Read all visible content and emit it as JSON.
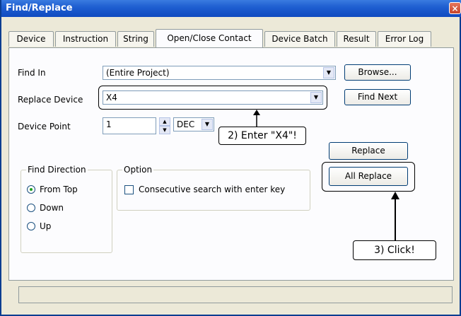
{
  "window": {
    "title": "Find/Replace",
    "close_glyph": "×"
  },
  "tabs": [
    "Device",
    "Instruction",
    "String",
    "Open/Close Contact",
    "Device Batch",
    "Result",
    "Error Log"
  ],
  "active_tab": "Open/Close Contact",
  "find_in": {
    "label": "Find In",
    "value": "(Entire Project)"
  },
  "replace_device": {
    "label": "Replace Device",
    "value": "X4"
  },
  "device_point": {
    "label": "Device Point",
    "value": "1",
    "format": "DEC"
  },
  "buttons": {
    "browse": "Browse...",
    "find_next": "Find Next",
    "replace": "Replace",
    "all_replace": "All Replace"
  },
  "find_direction": {
    "title": "Find Direction",
    "options": [
      "From Top",
      "Down",
      "Up"
    ],
    "selected": "From Top"
  },
  "option": {
    "title": "Option",
    "checkbox_label": "Consecutive search with enter key",
    "checked": false
  },
  "annotations": {
    "step2": "2) Enter \"X4\"!",
    "step3": "3) Click!"
  },
  "icons": {
    "dropdown": "chevron-down-icon",
    "spin_up": "spin-up-icon",
    "spin_down": "spin-down-icon",
    "close": "close-icon",
    "arrow": "arrow-up-icon"
  }
}
